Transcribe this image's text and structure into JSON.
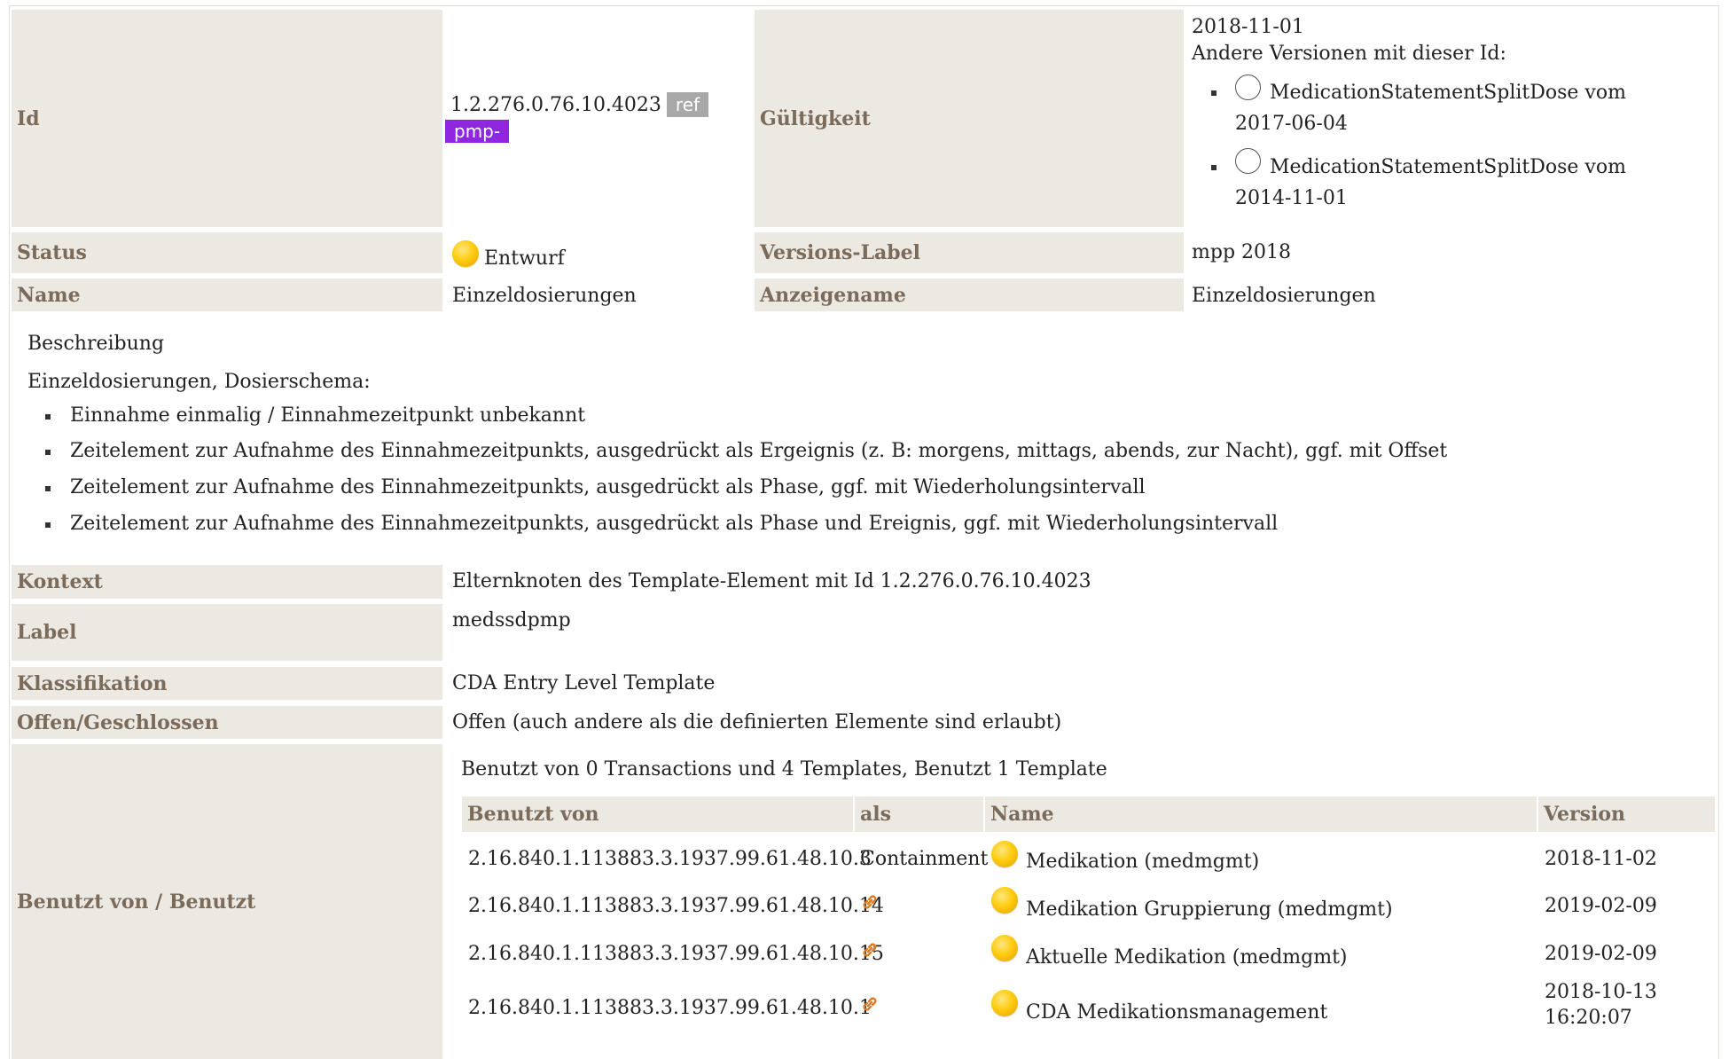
{
  "id_row": {
    "label": "Id",
    "value": "1.2.276.0.76.10.4023",
    "tag_ref": "ref",
    "tag_pmp": "pmp-",
    "validity_label": "Gültigkeit",
    "validity_date": "2018-11-01",
    "other_versions_title": "Andere Versionen mit dieser Id:",
    "other_versions": [
      {
        "name": "MedicationStatementSplitDose vom",
        "date": "2017-06-04"
      },
      {
        "name": "MedicationStatementSplitDose vom",
        "date": "2014-11-01"
      }
    ]
  },
  "status_row": {
    "label": "Status",
    "value": "Entwurf",
    "version_label_label": "Versions-Label",
    "version_label_value": "mpp 2018"
  },
  "name_row": {
    "label": "Name",
    "value": "Einzeldosierungen",
    "display_name_label": "Anzeigename",
    "display_name_value": "Einzeldosierungen"
  },
  "description": {
    "heading": "Beschreibung",
    "intro": "Einzeldosierungen, Dosierschema:",
    "items": [
      "Einnahme einmalig / Einnahmezeitpunkt unbekannt",
      "Zeitelement zur Aufnahme des Einnahmezeitpunkts, ausgedrückt als Ergeignis (z. B: morgens, mittags, abends, zur Nacht), ggf. mit Offset",
      "Zeitelement zur Aufnahme des Einnahmezeitpunkts, ausgedrückt als Phase, ggf. mit Wiederholungsintervall",
      "Zeitelement zur Aufnahme des Einnahmezeitpunkts, ausgedrückt als Phase und Ereignis, ggf. mit Wiederholungsintervall"
    ]
  },
  "context_row": {
    "label": "Kontext",
    "value": "Elternknoten des Template-Element mit Id 1.2.276.0.76.10.4023"
  },
  "label_row": {
    "label": "Label",
    "value": "medssdpmp"
  },
  "class_row": {
    "label": "Klassifikation",
    "value": "CDA Entry Level Template"
  },
  "open_row": {
    "label": "Offen/Geschlossen",
    "value": "Offen (auch andere als die definierten Elemente sind erlaubt)"
  },
  "usage": {
    "label": "Benutzt von / Benutzt",
    "summary": "Benutzt von 0 Transactions und 4 Templates, Benutzt 1 Template",
    "columns": [
      "Benutzt von",
      "als",
      "Name",
      "Version"
    ],
    "rows": [
      {
        "id": "2.16.840.1.113883.3.1937.99.61.48.10.3",
        "as": "Containment",
        "as_icon": "",
        "name": "Medikation (medmgmt)",
        "version": "2018-11-02",
        "version2": ""
      },
      {
        "id": "2.16.840.1.113883.3.1937.99.61.48.10.14",
        "as": "",
        "as_icon": "link-icon",
        "name": "Medikation Gruppierung (medmgmt)",
        "version": "2019-02-09",
        "version2": ""
      },
      {
        "id": "2.16.840.1.113883.3.1937.99.61.48.10.15",
        "as": "",
        "as_icon": "link-icon",
        "name": "Aktuelle Medikation (medmgmt)",
        "version": "2019-02-09",
        "version2": ""
      },
      {
        "id": "2.16.840.1.113883.3.1937.99.61.48.10.1",
        "as": "",
        "as_icon": "link-icon",
        "name": "CDA Medikationsmanagement",
        "version": "2018-10-13",
        "version2": "16:20:07"
      }
    ]
  },
  "colors": {
    "header_bg": "#ece8e2",
    "header_text": "#7a6b5a",
    "status_draft": "#ffcc10",
    "tag_ref": "#a8a8a8",
    "tag_pmp": "#8f26e0",
    "link_icon": "#e07a20"
  }
}
